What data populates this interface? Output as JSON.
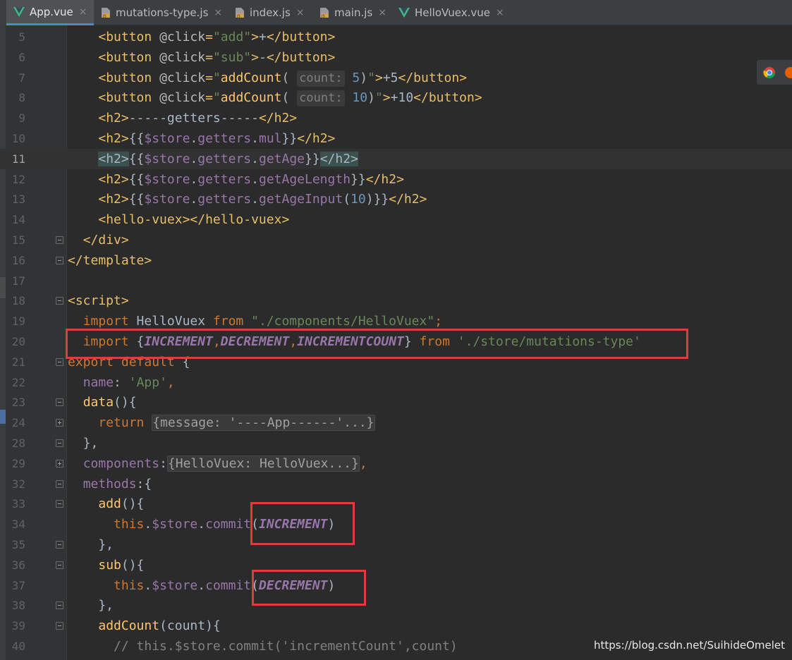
{
  "tabs": [
    {
      "label": "App.vue",
      "icon": "vue-icon",
      "active": true
    },
    {
      "label": "mutations-type.js",
      "icon": "js-file-icon",
      "active": false
    },
    {
      "label": "index.js",
      "icon": "js-file-icon",
      "active": false
    },
    {
      "label": "main.js",
      "icon": "js-file-icon",
      "active": false
    },
    {
      "label": "HelloVuex.vue",
      "icon": "vue-icon",
      "active": false
    }
  ],
  "close_glyph": "×",
  "current_line": "11",
  "lines": [
    {
      "n": "5",
      "fold": "",
      "spans": [
        [
          "plain",
          "    "
        ],
        [
          "tag",
          "<button "
        ],
        [
          "attr",
          "@click"
        ],
        [
          "tag",
          "="
        ],
        [
          "str",
          "\"add\""
        ],
        [
          "tag",
          ">"
        ],
        [
          "plain",
          "+"
        ],
        [
          "tag",
          "</button>"
        ]
      ]
    },
    {
      "n": "6",
      "fold": "",
      "spans": [
        [
          "plain",
          "    "
        ],
        [
          "tag",
          "<button "
        ],
        [
          "attr",
          "@click"
        ],
        [
          "tag",
          "="
        ],
        [
          "str",
          "\"sub\""
        ],
        [
          "tag",
          ">"
        ],
        [
          "plain",
          "-"
        ],
        [
          "tag",
          "</button>"
        ]
      ]
    },
    {
      "n": "7",
      "fold": "",
      "spans": [
        [
          "plain",
          "    "
        ],
        [
          "tag",
          "<button "
        ],
        [
          "attr",
          "@click"
        ],
        [
          "tag",
          "="
        ],
        [
          "str",
          "\""
        ],
        [
          "fn",
          "addCount"
        ],
        [
          "plain",
          "( "
        ],
        [
          "hint",
          "count:"
        ],
        [
          "num",
          " 5"
        ],
        [
          "plain",
          ")"
        ],
        [
          "str",
          "\""
        ],
        [
          "tag",
          ">"
        ],
        [
          "plain",
          "+5"
        ],
        [
          "tag",
          "</button>"
        ]
      ]
    },
    {
      "n": "8",
      "fold": "",
      "spans": [
        [
          "plain",
          "    "
        ],
        [
          "tag",
          "<button "
        ],
        [
          "attr",
          "@click"
        ],
        [
          "tag",
          "="
        ],
        [
          "str",
          "\""
        ],
        [
          "fn",
          "addCount"
        ],
        [
          "plain",
          "( "
        ],
        [
          "hint",
          "count:"
        ],
        [
          "num",
          " 10"
        ],
        [
          "plain",
          ")"
        ],
        [
          "str",
          "\""
        ],
        [
          "tag",
          ">"
        ],
        [
          "plain",
          "+10"
        ],
        [
          "tag",
          "</button>"
        ]
      ]
    },
    {
      "n": "9",
      "fold": "",
      "spans": [
        [
          "plain",
          "    "
        ],
        [
          "tag",
          "<h2>"
        ],
        [
          "plain",
          "-----getters-----"
        ],
        [
          "tag",
          "</h2>"
        ]
      ]
    },
    {
      "n": "10",
      "fold": "",
      "spans": [
        [
          "plain",
          "    "
        ],
        [
          "tag",
          "<h2>"
        ],
        [
          "plain",
          "{{"
        ],
        [
          "purple",
          "$store"
        ],
        [
          "plain",
          "."
        ],
        [
          "purple",
          "getters"
        ],
        [
          "plain",
          "."
        ],
        [
          "purple",
          "mul"
        ],
        [
          "plain",
          "}}"
        ],
        [
          "tag",
          "</h2>"
        ]
      ]
    },
    {
      "n": "11",
      "fold": "",
      "spans": [
        [
          "plain",
          "    "
        ],
        [
          "tagmatch",
          "<h2>"
        ],
        [
          "plain",
          "{{"
        ],
        [
          "purple",
          "$store"
        ],
        [
          "plain",
          "."
        ],
        [
          "purple",
          "getters"
        ],
        [
          "plain",
          "."
        ],
        [
          "purple",
          "getAge"
        ],
        [
          "plain",
          "}}"
        ],
        [
          "tagmatch",
          "</h2>"
        ]
      ]
    },
    {
      "n": "12",
      "fold": "",
      "spans": [
        [
          "plain",
          "    "
        ],
        [
          "tag",
          "<h2>"
        ],
        [
          "plain",
          "{{"
        ],
        [
          "purple",
          "$store"
        ],
        [
          "plain",
          "."
        ],
        [
          "purple",
          "getters"
        ],
        [
          "plain",
          "."
        ],
        [
          "purple",
          "getAgeLength"
        ],
        [
          "plain",
          "}}"
        ],
        [
          "tag",
          "</h2>"
        ]
      ]
    },
    {
      "n": "13",
      "fold": "",
      "spans": [
        [
          "plain",
          "    "
        ],
        [
          "tag",
          "<h2>"
        ],
        [
          "plain",
          "{{"
        ],
        [
          "purple",
          "$store"
        ],
        [
          "plain",
          "."
        ],
        [
          "purple",
          "getters"
        ],
        [
          "plain",
          "."
        ],
        [
          "purple",
          "getAgeInput"
        ],
        [
          "plain",
          "("
        ],
        [
          "num",
          "10"
        ],
        [
          "plain",
          ")}}"
        ],
        [
          "tag",
          "</h2>"
        ]
      ]
    },
    {
      "n": "14",
      "fold": "",
      "spans": [
        [
          "plain",
          "    "
        ],
        [
          "tag",
          "<hello-vuex></hello-vuex>"
        ]
      ]
    },
    {
      "n": "15",
      "fold": "minus",
      "spans": [
        [
          "plain",
          "  "
        ],
        [
          "tag",
          "</div>"
        ]
      ]
    },
    {
      "n": "16",
      "fold": "minus",
      "spans": [
        [
          "tag",
          "</template>"
        ]
      ]
    },
    {
      "n": "17",
      "fold": "",
      "spans": []
    },
    {
      "n": "18",
      "fold": "minus",
      "spans": [
        [
          "tag",
          "<script>"
        ]
      ]
    },
    {
      "n": "19",
      "fold": "",
      "spans": [
        [
          "plain",
          "  "
        ],
        [
          "kw",
          "import "
        ],
        [
          "plain",
          "HelloVuex "
        ],
        [
          "kw",
          "from "
        ],
        [
          "str",
          "\"./components/HelloVuex\""
        ],
        [
          "kw",
          ";"
        ]
      ]
    },
    {
      "n": "20",
      "fold": "",
      "spans": [
        [
          "plain",
          "  "
        ],
        [
          "kw",
          "import "
        ],
        [
          "plain",
          "{"
        ],
        [
          "const",
          "INCREMENT"
        ],
        [
          "kw",
          ","
        ],
        [
          "const",
          "DECREMENT"
        ],
        [
          "kw",
          ","
        ],
        [
          "const",
          "INCREMENTCOUNT"
        ],
        [
          "plain",
          "} "
        ],
        [
          "kw",
          "from "
        ],
        [
          "str",
          "'./store/mutations-type'"
        ]
      ]
    },
    {
      "n": "21",
      "fold": "minus",
      "spans": [
        [
          "kw",
          "export default "
        ],
        [
          "plain",
          "{"
        ]
      ]
    },
    {
      "n": "22",
      "fold": "",
      "spans": [
        [
          "plain",
          "  "
        ],
        [
          "purple",
          "name"
        ],
        [
          "plain",
          ": "
        ],
        [
          "str",
          "'App'"
        ],
        [
          "kw",
          ","
        ]
      ]
    },
    {
      "n": "23",
      "fold": "minus",
      "spans": [
        [
          "plain",
          "  "
        ],
        [
          "fn",
          "data"
        ],
        [
          "plain",
          "(){"
        ]
      ]
    },
    {
      "n": "24",
      "fold": "plus",
      "spans": [
        [
          "plain",
          "    "
        ],
        [
          "kw",
          "return "
        ],
        [
          "folded",
          "{message: '----App------'...}"
        ]
      ]
    },
    {
      "n": "28",
      "fold": "minus",
      "spans": [
        [
          "plain",
          "  },"
        ]
      ]
    },
    {
      "n": "29",
      "fold": "plus",
      "spans": [
        [
          "plain",
          "  "
        ],
        [
          "purple",
          "components"
        ],
        [
          "plain",
          ":"
        ],
        [
          "folded",
          "{HelloVuex: HelloVuex...}"
        ],
        [
          "kw",
          ","
        ]
      ]
    },
    {
      "n": "32",
      "fold": "minus",
      "spans": [
        [
          "plain",
          "  "
        ],
        [
          "purple",
          "methods"
        ],
        [
          "plain",
          ":{"
        ]
      ]
    },
    {
      "n": "33",
      "fold": "minus",
      "spans": [
        [
          "plain",
          "    "
        ],
        [
          "fn",
          "add"
        ],
        [
          "plain",
          "(){"
        ]
      ]
    },
    {
      "n": "34",
      "fold": "",
      "spans": [
        [
          "plain",
          "      "
        ],
        [
          "kw",
          "this"
        ],
        [
          "plain",
          "."
        ],
        [
          "purple",
          "$store"
        ],
        [
          "plain",
          "."
        ],
        [
          "purple",
          "commit"
        ],
        [
          "plain",
          "("
        ],
        [
          "const",
          "INCREMENT"
        ],
        [
          "plain",
          ")"
        ]
      ]
    },
    {
      "n": "35",
      "fold": "minus",
      "spans": [
        [
          "plain",
          "    },"
        ]
      ]
    },
    {
      "n": "36",
      "fold": "minus",
      "spans": [
        [
          "plain",
          "    "
        ],
        [
          "fn",
          "sub"
        ],
        [
          "plain",
          "(){"
        ]
      ]
    },
    {
      "n": "37",
      "fold": "",
      "spans": [
        [
          "plain",
          "      "
        ],
        [
          "kw",
          "this"
        ],
        [
          "plain",
          "."
        ],
        [
          "purple",
          "$store"
        ],
        [
          "plain",
          "."
        ],
        [
          "purple",
          "commit"
        ],
        [
          "plain",
          "("
        ],
        [
          "const",
          "DECREMENT"
        ],
        [
          "plain",
          ")"
        ]
      ]
    },
    {
      "n": "38",
      "fold": "minus",
      "spans": [
        [
          "plain",
          "    },"
        ]
      ]
    },
    {
      "n": "39",
      "fold": "minus",
      "spans": [
        [
          "plain",
          "    "
        ],
        [
          "fn",
          "addCount"
        ],
        [
          "plain",
          "(count){"
        ]
      ]
    },
    {
      "n": "40",
      "fold": "",
      "spans": [
        [
          "plain",
          "      "
        ],
        [
          "cmt",
          "// this.$store.commit('incrementCount',count)"
        ]
      ]
    }
  ],
  "watermark": "https://blog.csdn.net/SuihideOmelet",
  "colors": {
    "annotation_box": "#e23b3b",
    "active_tab_underline": "#4a88c7",
    "editor_bg": "#2b2b2b"
  }
}
